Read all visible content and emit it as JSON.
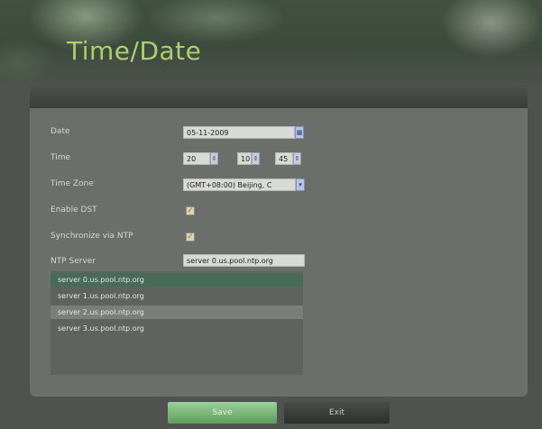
{
  "header": {
    "title": "Time/Date"
  },
  "form": {
    "date": {
      "label": "Date",
      "value": "05-11-2009"
    },
    "time": {
      "label": "Time",
      "hour": "20",
      "minute": "10",
      "second": "45"
    },
    "time_zone": {
      "label": "Time Zone",
      "value": "(GMT+08:00) Beijing, C"
    },
    "enable_dst": {
      "label": "Enable DST",
      "checked": true,
      "mark": "✓"
    },
    "sync_ntp": {
      "label": "Synchronize via NTP",
      "checked": true,
      "mark": "✓"
    },
    "ntp_server": {
      "label": "NTP Server",
      "value": "server 0.us.pool.ntp.org"
    }
  },
  "ntp_list": [
    {
      "label": "server 0.us.pool.ntp.org",
      "selected": true
    },
    {
      "label": "server 1.us.pool.ntp.org",
      "selected": false
    },
    {
      "label": "server 2.us.pool.ntp.org",
      "selected": false
    },
    {
      "label": "server 3.us.pool.ntp.org",
      "selected": false
    }
  ],
  "buttons": {
    "save": "Save",
    "exit": "Exit"
  },
  "colors": {
    "title": "#a9d36a",
    "save": "#7fbf7f",
    "selected_row": "#486a59",
    "highlight_row": "#7b7e79"
  }
}
